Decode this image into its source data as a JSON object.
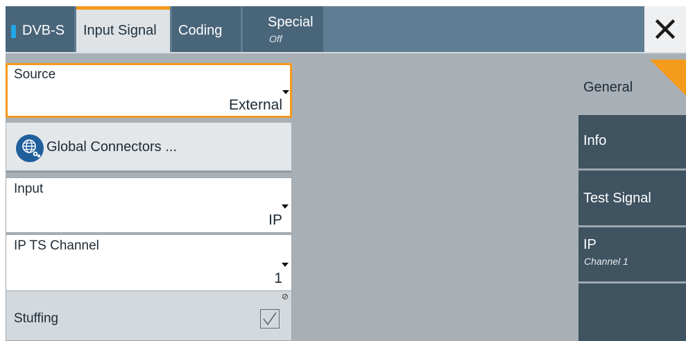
{
  "tabs": {
    "dvbs": {
      "label": "DVB-S"
    },
    "input_signal": {
      "label": "Input Signal"
    },
    "coding": {
      "label": "Coding"
    },
    "special": {
      "label": "Special",
      "sub": "Off"
    }
  },
  "close_icon": "close-icon",
  "source": {
    "label": "Source",
    "value": "External"
  },
  "global_connectors": {
    "label": "Global Connectors ...",
    "icon": "globe-gear-icon"
  },
  "input": {
    "label": "Input",
    "value": "IP"
  },
  "ip_ts_channel": {
    "label": "IP TS Channel",
    "value": "1"
  },
  "stuffing": {
    "label": "Stuffing",
    "checked": true
  },
  "sidenav": {
    "general": "General",
    "info": "Info",
    "test_signal": "Test Signal",
    "ip": {
      "label": "IP",
      "sub": "Channel 1"
    }
  },
  "colors": {
    "accent": "#f49a1c",
    "tab_dark": "#49657a",
    "nav_dark": "#3f5360",
    "panel_bg": "#a8b0b6",
    "dvbs_marker": "#22a7e6"
  }
}
